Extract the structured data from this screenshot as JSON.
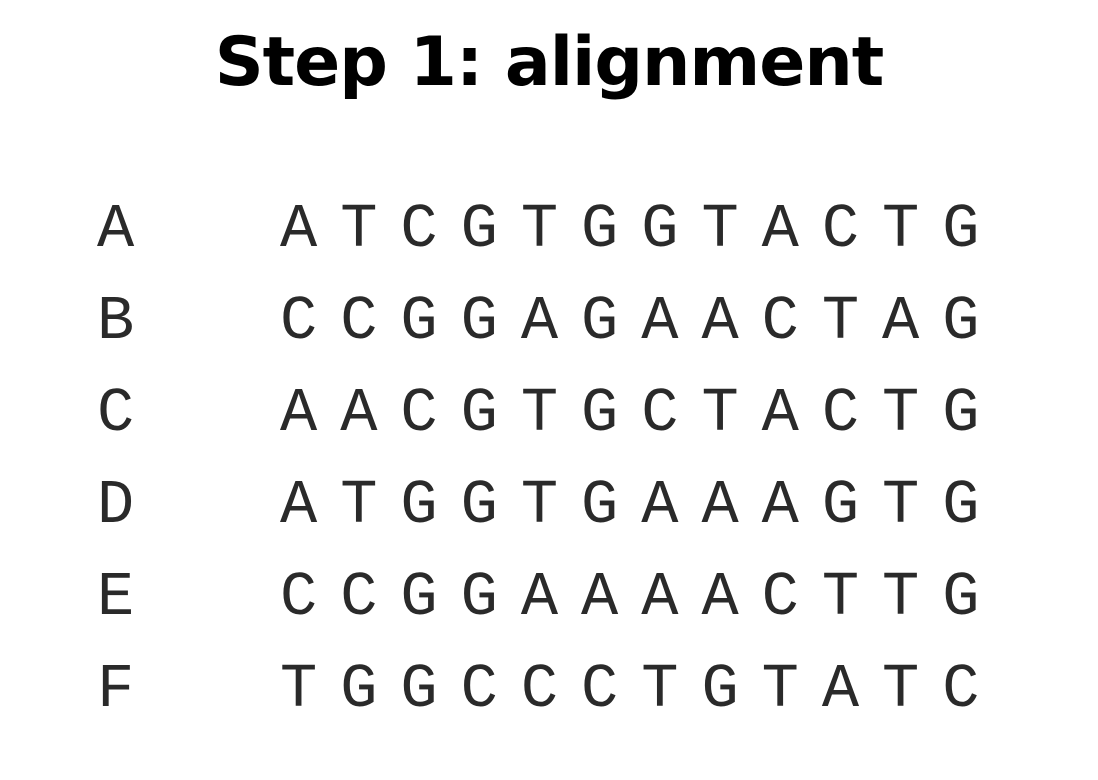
{
  "title": "Step 1: alignment",
  "sequences": [
    {
      "label": "A",
      "bases": "ATCGTGGTACTG"
    },
    {
      "label": "B",
      "bases": "CCGGAGAACTAG"
    },
    {
      "label": "C",
      "bases": "AACGTGCTACTG"
    },
    {
      "label": "D",
      "bases": "ATGGTGAAAGTG"
    },
    {
      "label": "E",
      "bases": "CCGGAAAACTTG"
    },
    {
      "label": "F",
      "bases": "TGGCCCTGTATC"
    }
  ]
}
